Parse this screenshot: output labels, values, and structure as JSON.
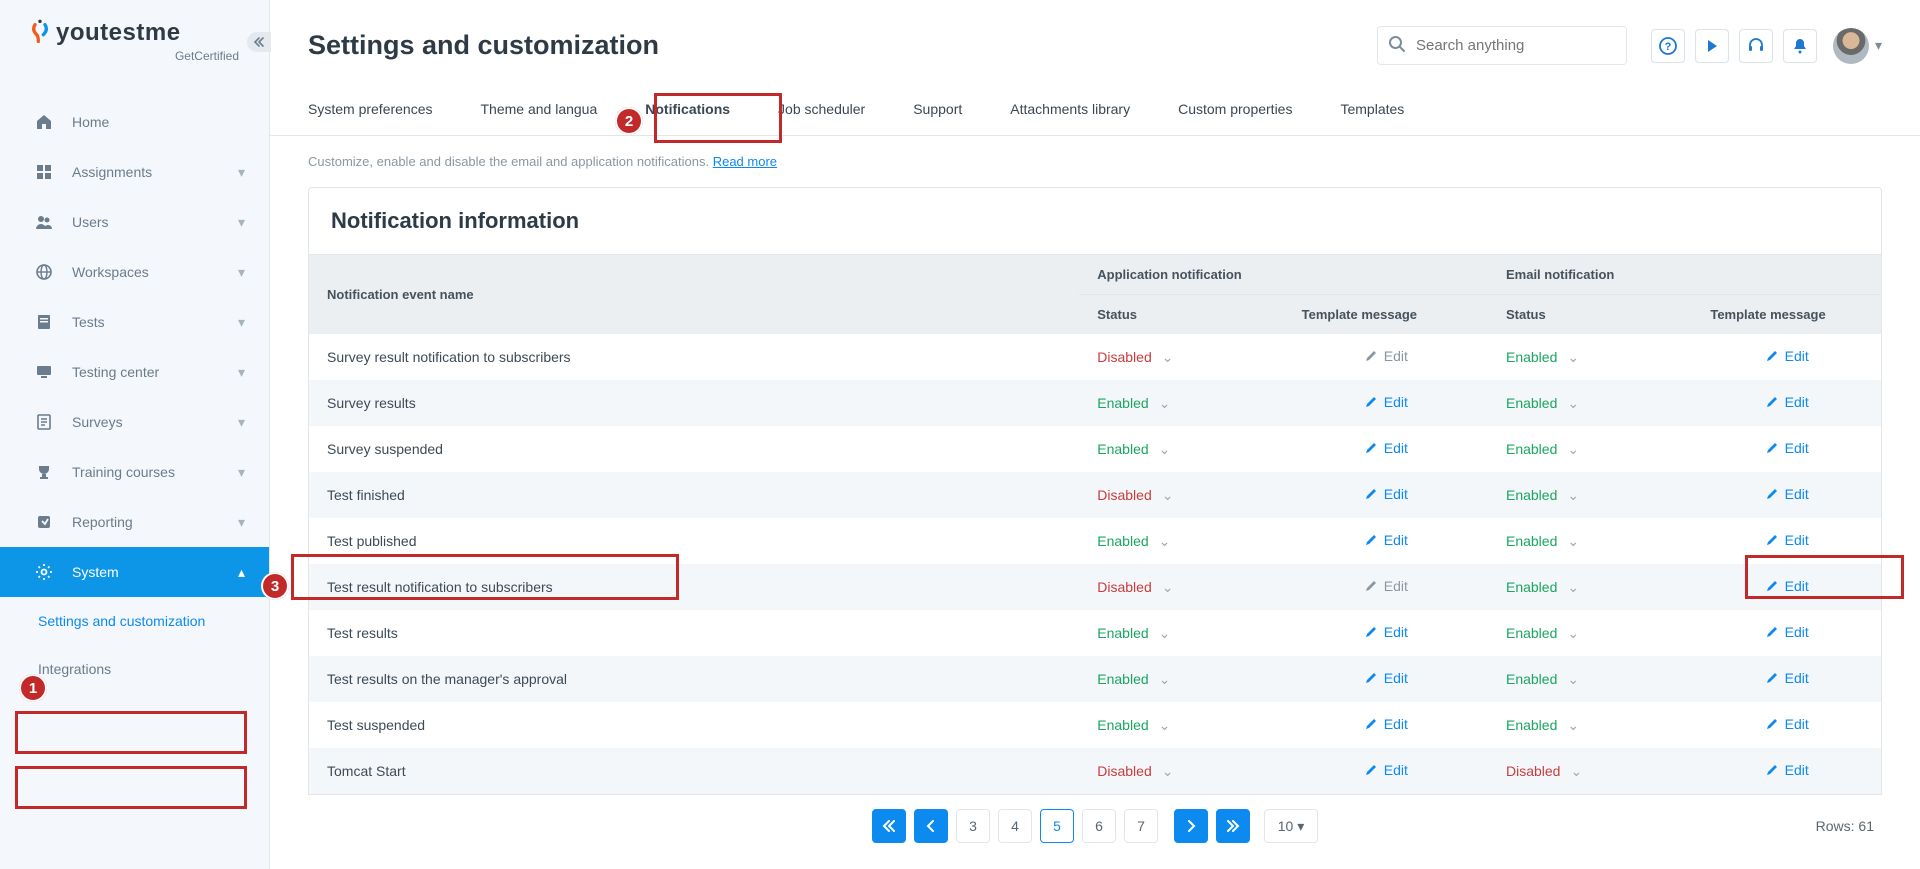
{
  "brand": {
    "name": "youtestme",
    "tagline": "GetCertified"
  },
  "sidebar": {
    "items": [
      {
        "label": "Home",
        "icon": "home"
      },
      {
        "label": "Assignments",
        "icon": "assignments",
        "expandable": true
      },
      {
        "label": "Users",
        "icon": "users",
        "expandable": true
      },
      {
        "label": "Workspaces",
        "icon": "globe",
        "expandable": true
      },
      {
        "label": "Tests",
        "icon": "tests",
        "expandable": true
      },
      {
        "label": "Testing center",
        "icon": "monitor",
        "expandable": true
      },
      {
        "label": "Surveys",
        "icon": "survey",
        "expandable": true
      },
      {
        "label": "Training courses",
        "icon": "trophy",
        "expandable": true
      },
      {
        "label": "Reporting",
        "icon": "report",
        "expandable": true
      },
      {
        "label": "System",
        "icon": "gear",
        "expandable": true,
        "active": true
      },
      {
        "label": "Settings and customization",
        "sub": true,
        "activeText": true
      },
      {
        "label": "Integrations",
        "sub": true
      }
    ]
  },
  "page_title": "Settings and customization",
  "search": {
    "placeholder": "Search anything"
  },
  "tabs": [
    "System preferences",
    "Theme and langua",
    "Notifications",
    "Job scheduler",
    "Support",
    "Attachments library",
    "Custom properties",
    "Templates"
  ],
  "active_tab_index": 2,
  "description": {
    "text": "Customize, enable and disable the email and application notifications. ",
    "link": "Read more"
  },
  "panel_title": "Notification information",
  "columns": {
    "event": "Notification event name",
    "app_group": "Application notification",
    "email_group": "Email notification",
    "status": "Status",
    "template": "Template message"
  },
  "rows": [
    {
      "name": "Survey result notification to subscribers",
      "appStatus": "Disabled",
      "appEdit": "Edit",
      "appEditEnabled": false,
      "emailStatus": "Enabled",
      "emailEdit": "Edit",
      "emailEditEnabled": true
    },
    {
      "name": "Survey results",
      "appStatus": "Enabled",
      "appEdit": "Edit",
      "appEditEnabled": true,
      "emailStatus": "Enabled",
      "emailEdit": "Edit",
      "emailEditEnabled": true
    },
    {
      "name": "Survey suspended",
      "appStatus": "Enabled",
      "appEdit": "Edit",
      "appEditEnabled": true,
      "emailStatus": "Enabled",
      "emailEdit": "Edit",
      "emailEditEnabled": true
    },
    {
      "name": "Test finished",
      "appStatus": "Disabled",
      "appEdit": "Edit",
      "appEditEnabled": true,
      "emailStatus": "Enabled",
      "emailEdit": "Edit",
      "emailEditEnabled": true
    },
    {
      "name": "Test published",
      "appStatus": "Enabled",
      "appEdit": "Edit",
      "appEditEnabled": true,
      "emailStatus": "Enabled",
      "emailEdit": "Edit",
      "emailEditEnabled": true
    },
    {
      "name": "Test result notification to subscribers",
      "appStatus": "Disabled",
      "appEdit": "Edit",
      "appEditEnabled": false,
      "emailStatus": "Enabled",
      "emailEdit": "Edit",
      "emailEditEnabled": true
    },
    {
      "name": "Test results",
      "appStatus": "Enabled",
      "appEdit": "Edit",
      "appEditEnabled": true,
      "emailStatus": "Enabled",
      "emailEdit": "Edit",
      "emailEditEnabled": true
    },
    {
      "name": "Test results on the manager's approval",
      "appStatus": "Enabled",
      "appEdit": "Edit",
      "appEditEnabled": true,
      "emailStatus": "Enabled",
      "emailEdit": "Edit",
      "emailEditEnabled": true
    },
    {
      "name": "Test suspended",
      "appStatus": "Enabled",
      "appEdit": "Edit",
      "appEditEnabled": true,
      "emailStatus": "Enabled",
      "emailEdit": "Edit",
      "emailEditEnabled": true
    },
    {
      "name": "Tomcat Start",
      "appStatus": "Disabled",
      "appEdit": "Edit",
      "appEditEnabled": true,
      "emailStatus": "Disabled",
      "emailEdit": "Edit",
      "emailEditEnabled": true
    }
  ],
  "pagination": {
    "pages": [
      "3",
      "4",
      "5",
      "6",
      "7"
    ],
    "current": "5",
    "page_size": "10",
    "total_label": "Rows: 61"
  },
  "annotations": [
    1,
    2,
    3
  ]
}
